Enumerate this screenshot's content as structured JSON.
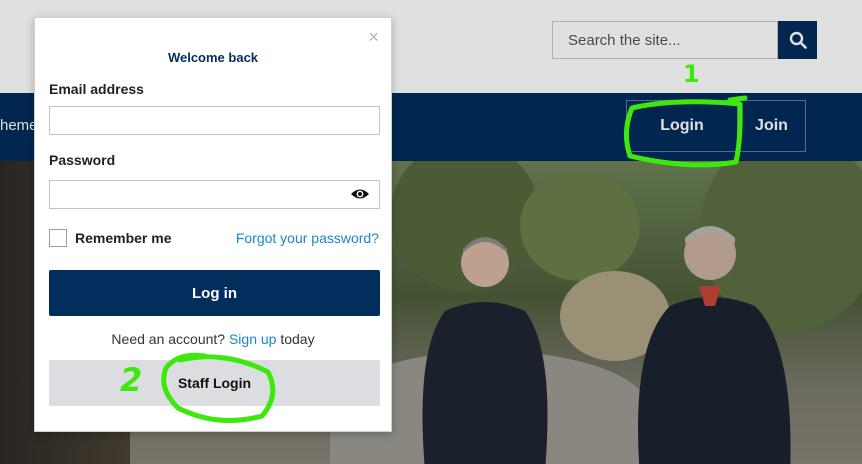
{
  "header": {
    "search_placeholder": "Search the site...",
    "nav_partial": "heme",
    "login_label": "Login",
    "join_label": "Join"
  },
  "modal": {
    "title": "Welcome back",
    "close_glyph": "×",
    "email_label": "Email address",
    "email_value": "",
    "password_label": "Password",
    "password_value": "",
    "remember_label": "Remember me",
    "forgot_link": "Forgot your password?",
    "submit_label": "Log in",
    "need_account_prefix": "Need an account?",
    "signup_link": "Sign up",
    "need_account_suffix": "today",
    "staff_login_label": "Staff Login"
  },
  "annotations": {
    "mark_1": "1",
    "mark_2": "2"
  },
  "colors": {
    "brand_navy": "#022d5c",
    "link_blue": "#1a87c9",
    "annotation_green": "#3ee80e"
  }
}
